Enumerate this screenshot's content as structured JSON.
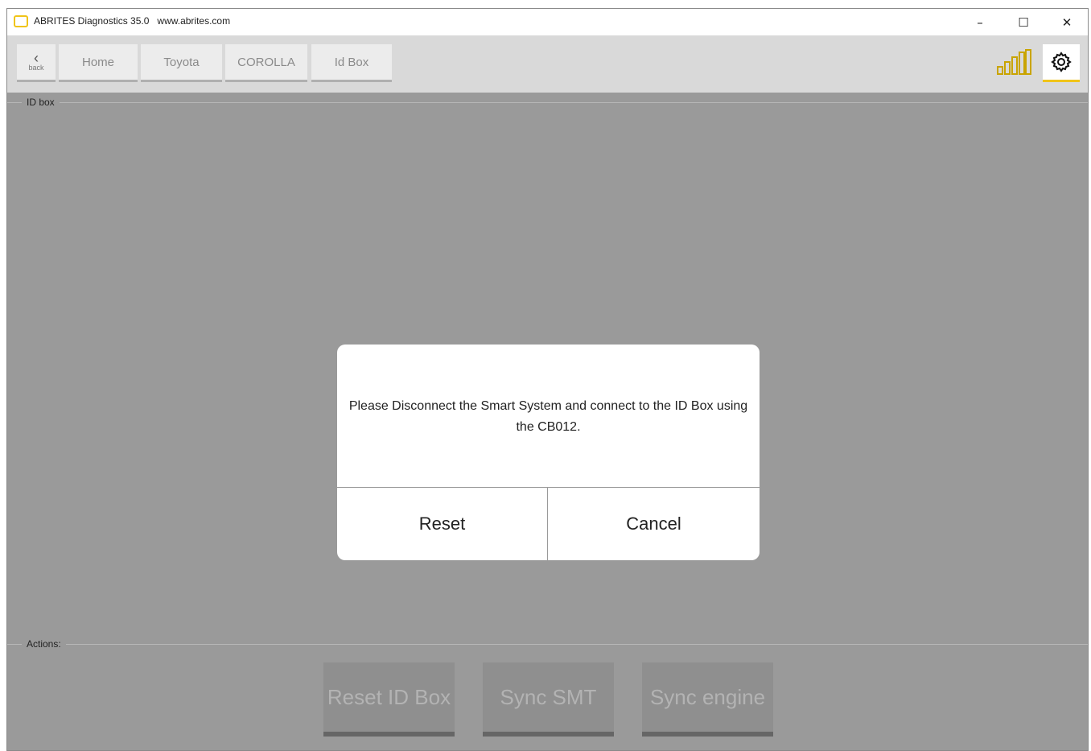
{
  "window": {
    "title": "ABRITES Diagnostics 35.0   www.abrites.com",
    "controls": {
      "minimize": "–",
      "maximize": "☐",
      "close": "✕"
    }
  },
  "toolbar": {
    "back_label": "back",
    "breadcrumbs": [
      "Home",
      "Toyota",
      "COROLLA",
      "Id Box"
    ],
    "signal_icon": "signal-bars-icon",
    "settings_icon": "gear-icon",
    "accent_color": "#f0c419"
  },
  "id_box": {
    "legend": "ID box"
  },
  "dialog": {
    "message": "Please Disconnect the Smart System and connect to the ID Box using the CB012.",
    "reset_label": "Reset",
    "cancel_label": "Cancel"
  },
  "actions": {
    "legend": "Actions:",
    "buttons": [
      "Reset ID Box",
      "Sync SMT",
      "Sync engine"
    ]
  }
}
